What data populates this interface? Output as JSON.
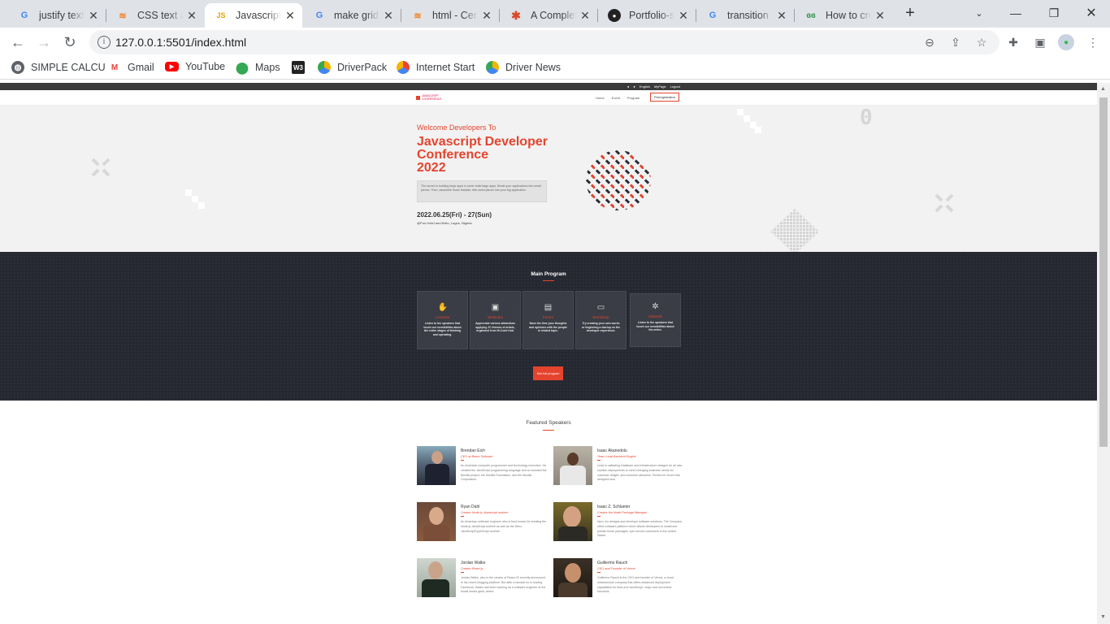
{
  "browser": {
    "tabs": [
      {
        "title": "justify text",
        "icon": "google-icon",
        "active": false
      },
      {
        "title": "CSS text ali",
        "icon": "stackoverflow-icon",
        "active": false
      },
      {
        "title": "Javascript",
        "icon": "js-icon",
        "active": true
      },
      {
        "title": "make grid",
        "icon": "google-icon",
        "active": false
      },
      {
        "title": "html - Cen",
        "icon": "stackoverflow-icon",
        "active": false
      },
      {
        "title": "A Complet",
        "icon": "asterisk-icon",
        "active": false
      },
      {
        "title": "Portfolio-s",
        "icon": "github-icon",
        "active": false
      },
      {
        "title": "transition",
        "icon": "google-icon",
        "active": false
      },
      {
        "title": "How to cre",
        "icon": "gfg-icon",
        "active": false
      }
    ],
    "url": "127.0.0.1:5501/index.html",
    "bookmarks": [
      {
        "label": "SIMPLE CALCU",
        "icon": "globe-icon"
      },
      {
        "label": "Gmail",
        "icon": "gmail-icon"
      },
      {
        "label": "YouTube",
        "icon": "youtube-icon"
      },
      {
        "label": "Maps",
        "icon": "maps-icon"
      },
      {
        "label": "",
        "icon": "w3-icon"
      },
      {
        "label": "DriverPack",
        "icon": "driverpack-icon"
      },
      {
        "label": "Internet Start",
        "icon": "internet-start-icon"
      },
      {
        "label": "Driver News",
        "icon": "driver-news-icon"
      }
    ]
  },
  "site": {
    "topstrip": {
      "lang": "English",
      "mypage": "MyPage",
      "logout": "Logout"
    },
    "logo_text": "JAVASCRIPT CONFERENCE",
    "menu": [
      "Home",
      "Event",
      "Program"
    ],
    "register": "Preregistration",
    "hero": {
      "welcome": "Welcome Developers To",
      "title_lines": [
        "Javascript Developer",
        "Conference",
        "2022"
      ],
      "description": "The secret to building large apps is never build large apps. Break your applications into small pieces. Then, assemble those testable, bite-sized pieces into your big application",
      "date": "2022.06.25(Fri) - 27(Sun)",
      "venue": "@Poo Hotel and Bolto, Lagos, Nigeria",
      "deco_number": "0"
    },
    "program": {
      "title": "Main Program",
      "cards": [
        {
          "name": "Lectures",
          "icon": "hand-icon",
          "desc": "Listen to the speakers that touch our sensibilities about the entire stages of thinking and operating."
        },
        {
          "name": "Webinars",
          "icon": "chat-icon",
          "desc": "Appreciate various attractions applying JC themes of artists, organized from W-Code Hub."
        },
        {
          "name": "Forum",
          "icon": "board-icon",
          "desc": "Have the time your thoughts and opinions with the people in related topic."
        },
        {
          "name": "Workshop",
          "icon": "monitor-icon",
          "desc": "Try creating your own works or beginning a startup on the developer experience."
        },
        {
          "name": "Network",
          "icon": "network-icon",
          "desc": "Listen to the speakers that touch our sensibilities about the entire."
        }
      ],
      "full_program": "See full program"
    },
    "speakers": {
      "title": "Featured Speakers",
      "list": [
        {
          "name": "Brendan Eich",
          "role": "CEO at Brave Software",
          "bio": "An American computer programmer and technology executive. He created the JavaScript programming language and co-founded the Mozilla project, the Mozilla Foundation, and the Mozilla Corporation."
        },
        {
          "name": "Isaac Akanedolu",
          "role": "Team Lead Backend Engine",
          "bio": "Lead in validating Database and Infrastructure designs for all new solution deployments to meet emerging business needs for customer delight, and customer attraction. Perfect for forum that designed and."
        },
        {
          "name": "Ryan Dahl",
          "role": "Creator Node.js Javascript runtime",
          "bio": "An American software engineer who is best known for creating the Node.js JavaScript runtime as well as the Deno JavaScript/TypeScript runtime."
        },
        {
          "name": "Isaac Z. Schlueter",
          "role": "Creator the Node Package Manager",
          "bio": "Npm, inc designs and develops software solutions. The Company offers software platform which allows developers to install and publish those packages, npm serves customers in the United States."
        },
        {
          "name": "Jordan Walke",
          "role": "Creator React.js",
          "bio": "Jordan Walke, who is the creator of React.JS recently announced in his recent blogging platform. But after a decade he is leaving Facebook. Walke had been working as a software engineer at the social media giant, where."
        },
        {
          "name": "Guillermo Rauch",
          "role": "CEO and Founder of Vercel",
          "bio": "Guillermo Rauch is the CEO and founder of Vercel, a cloud infrastructure company that offers advanced deployment capabilities for front-end JavaScript, major and serverless functions."
        }
      ]
    }
  }
}
